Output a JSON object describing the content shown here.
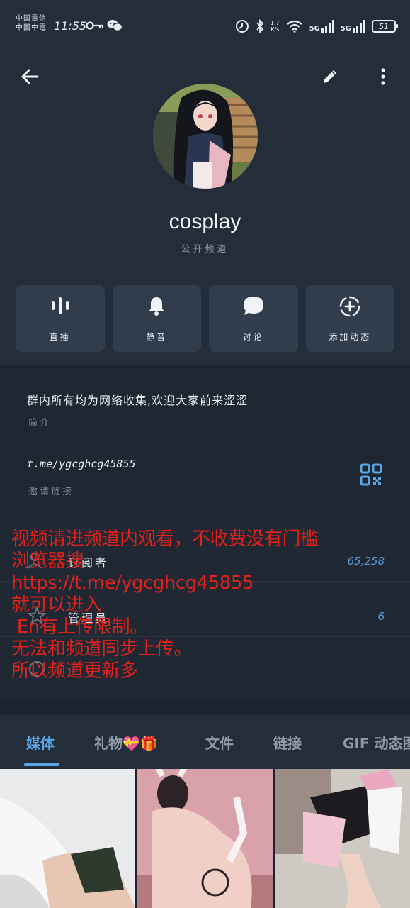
{
  "status_bar": {
    "carrier_line1": "中国電信",
    "carrier_line2": "中国中電",
    "time": "11:55",
    "speed_value": "1.7",
    "speed_unit": "K/s",
    "signal1": "5G",
    "signal2": "5G",
    "battery": "51",
    "icons": [
      "key-icon",
      "wechat-icon",
      "alarm-icon",
      "bluetooth-icon",
      "wifi-icon",
      "signal-icon",
      "battery-icon"
    ]
  },
  "header": {
    "channel_name": "cosplay",
    "channel_type": "公开频道"
  },
  "actions": [
    {
      "label": "直播",
      "icon": "live-icon"
    },
    {
      "label": "静音",
      "icon": "bell-icon"
    },
    {
      "label": "讨论",
      "icon": "chat-icon"
    },
    {
      "label": "添加动态",
      "icon": "add-story-icon"
    }
  ],
  "info": {
    "description": "群内所有均为网络收集,欢迎大家前来涩涩",
    "description_label": "简介",
    "link": "t.me/ygcghcg45855",
    "link_label": "邀请链接"
  },
  "stats": {
    "subscribers_label": "订阅者",
    "subscribers_value": "65,258",
    "admins_label": "管理员",
    "admins_value": "6"
  },
  "overlay_text": "视频请进频道内观看，不收费没有门槛\n浏览器搜\nhttps://t.me/ygcghcg45855\n就可以进入\n En有上传限制。\n无法和频道同步上传。\n所以频道更新多",
  "tabs": {
    "media": "媒体",
    "gifts": "礼物💝🎁",
    "files": "文件",
    "links": "链接",
    "gifs": "GIF 动态图"
  },
  "colors": {
    "accent": "#5aa7e8",
    "overlay_red": "#e3201b",
    "panel": "#242e3b"
  }
}
